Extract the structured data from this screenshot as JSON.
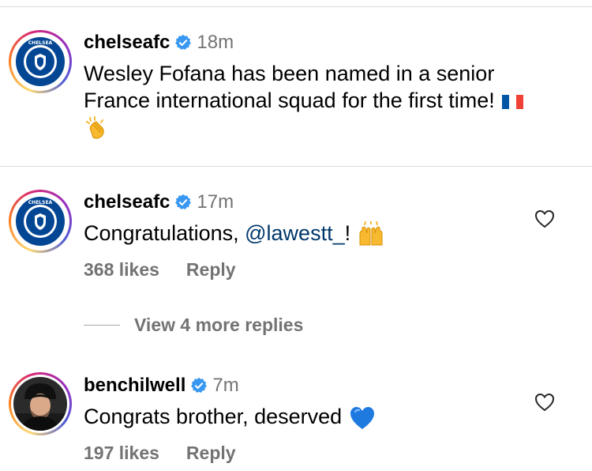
{
  "post": {
    "username": "chelseafc",
    "time": "18m",
    "caption_line1": "Wesley Fofana has been named in a senior",
    "caption_line2": "France international squad for the first time!",
    "emoji_flag": "france-flag-icon",
    "emoji_clap": "clapping-hands-icon"
  },
  "comments": [
    {
      "username": "chelseafc",
      "time": "17m",
      "text_prefix": "Congratulations, ",
      "mention": "@lawestt_",
      "text_suffix": "!",
      "likes": "368 likes",
      "reply": "Reply",
      "emoji": "raising-hands-icon"
    },
    {
      "username": "benchilwell",
      "time": "7m",
      "text": "Congrats brother, deserved",
      "likes": "197 likes",
      "reply": "Reply",
      "emoji": "blue-heart-icon"
    }
  ],
  "view_more": "View 4 more replies",
  "colors": {
    "verified": "#3897f0",
    "mention": "#00376b",
    "muted": "#737373",
    "chelsea_blue": "#034694"
  }
}
